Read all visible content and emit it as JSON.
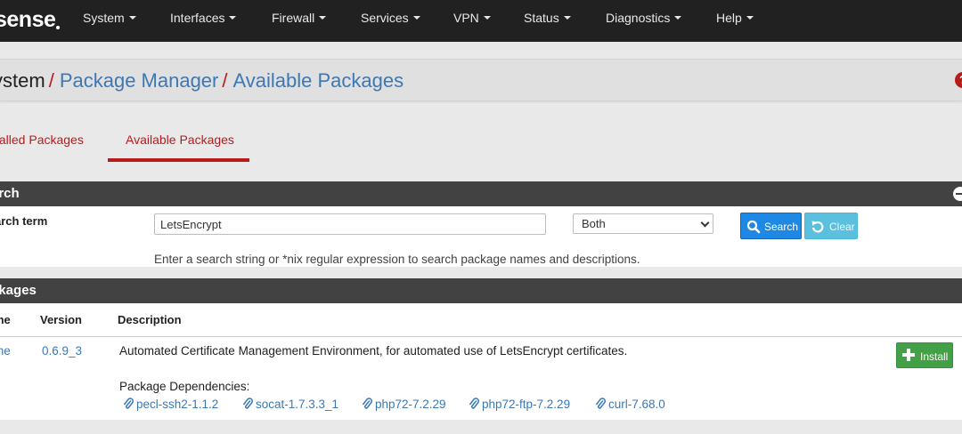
{
  "brand": {
    "logo_text": "sense"
  },
  "nav": {
    "items": [
      {
        "label": "System"
      },
      {
        "label": "Interfaces"
      },
      {
        "label": "Firewall"
      },
      {
        "label": "Services"
      },
      {
        "label": "VPN"
      },
      {
        "label": "Status"
      },
      {
        "label": "Diagnostics"
      },
      {
        "label": "Help"
      }
    ]
  },
  "breadcrumb": {
    "first": "ystem",
    "sep": "/",
    "second": "Package Manager",
    "third": "Available Packages",
    "help_glyph": "?"
  },
  "tabs": {
    "installed": "stalled Packages",
    "available": "Available Packages"
  },
  "search_panel": {
    "title": "arch",
    "term_label": "arch term",
    "input_value": "LetsEncrypt",
    "select_value": "Both",
    "search_button": "Search",
    "clear_button": "Clear",
    "help_text": "Enter a search string or *nix regular expression to search package names and descriptions."
  },
  "packages_panel": {
    "title": "ckages",
    "columns": {
      "name": "me",
      "version": "Version",
      "description": "Description"
    },
    "rows": [
      {
        "name": "me",
        "version": "0.6.9_3",
        "description": "Automated Certificate Management Environment, for automated use of LetsEncrypt certificates.",
        "deps_label": "Package Dependencies:",
        "deps": [
          "pecl-ssh2-1.1.2",
          "socat-1.7.3.3_1",
          "php72-7.2.29",
          "php72-ftp-7.2.29",
          "curl-7.68.0"
        ],
        "install_button": "Install"
      }
    ]
  },
  "colors": {
    "nav_bg": "#212121",
    "accent_red": "#b71c1c",
    "link_blue": "#3c78b5",
    "panel_head": "#424242",
    "search_btn": "#1e88e5",
    "clear_btn": "#5bc0de",
    "install_btn": "#43a047"
  },
  "icons": {
    "search": "magnifier-icon",
    "clear": "undo-icon",
    "install": "plus-icon",
    "dependency": "paperclip-icon",
    "collapse": "minus-circle-icon",
    "help": "question-circle-icon"
  }
}
